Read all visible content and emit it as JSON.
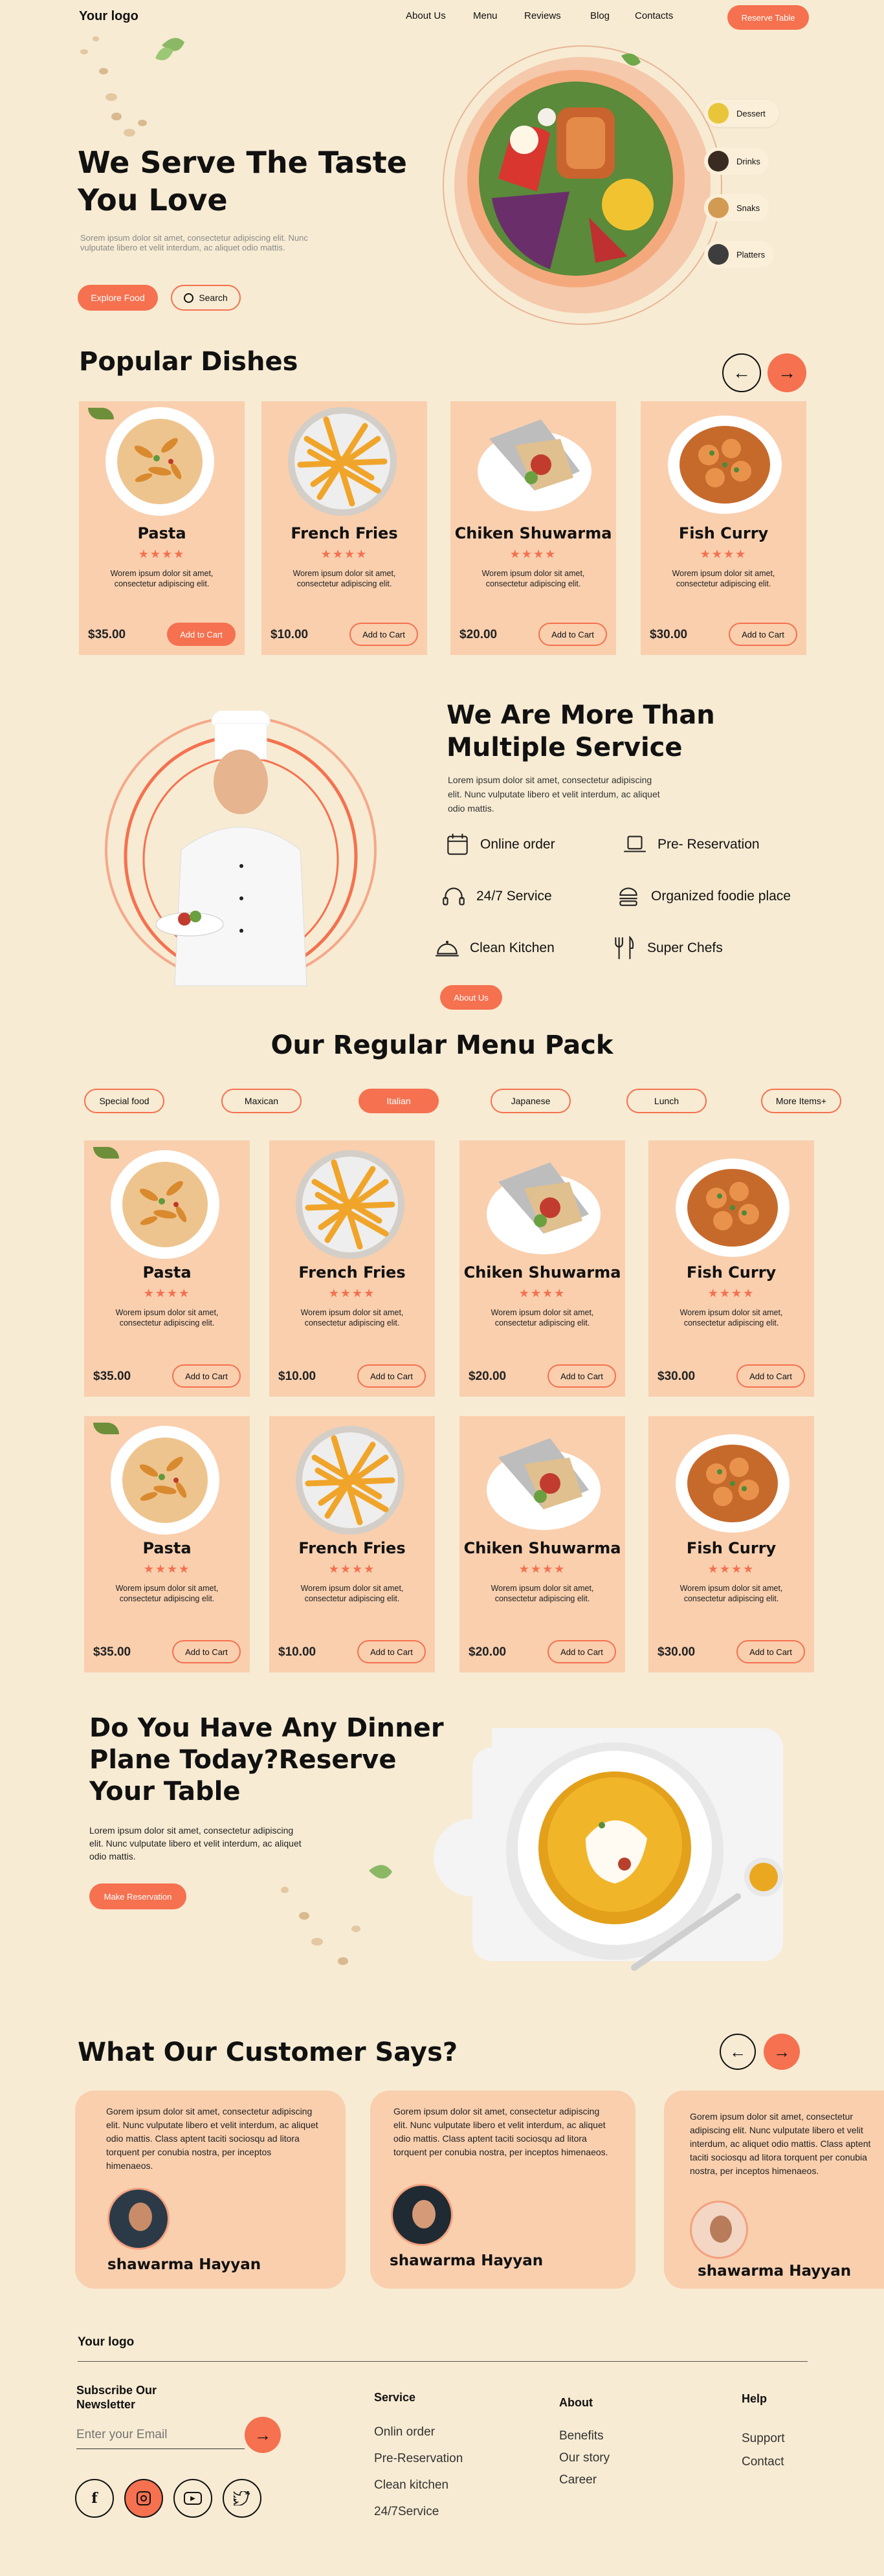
{
  "header": {
    "logo": "Your logo",
    "nav": [
      "About Us",
      "Menu",
      "Reviews",
      "Blog",
      "Contacts"
    ],
    "cta": "Reserve Table"
  },
  "hero": {
    "title_line1": "We Serve The Taste",
    "title_line2": "You Love",
    "text": "Sorem ipsum dolor sit amet, consectetur adipiscing elit. Nunc vulputate libero et velit interdum, ac aliquet odio mattis.",
    "explore": "Explore Food",
    "search": "Search",
    "categories": [
      "Dessert",
      "Drinks",
      "Snaks",
      "Platters"
    ]
  },
  "popular": {
    "title": "Popular Dishes",
    "dishes": [
      {
        "name": "Pasta",
        "price": "$35.00",
        "cart": "Add to Cart"
      },
      {
        "name": "French Fries",
        "price": "$10.00",
        "cart": "Add to Cart"
      },
      {
        "name": "Chiken Shuwarma",
        "price": "$20.00",
        "cart": "Add to Cart"
      },
      {
        "name": "Fish Curry",
        "price": "$30.00",
        "cart": "Add to Cart"
      }
    ],
    "stars": "★★★★",
    "desc": "Worem ipsum dolor sit amet, consectetur adipiscing elit."
  },
  "services": {
    "title_line1": "We Are More Than",
    "title_line2": "Multiple Service",
    "text": "Lorem ipsum dolor sit amet, consectetur adipiscing elit. Nunc vulputate libero et velit interdum, ac aliquet odio mattis.",
    "items": [
      "Online order",
      "Pre- Reservation",
      "24/7 Service",
      "Organized foodie place",
      "Clean Kitchen",
      "Super Chefs"
    ],
    "about": "About Us"
  },
  "menu": {
    "title": "Our Regular Menu Pack",
    "filters": [
      "Special food",
      "Maxican",
      "Italian",
      "Japanese",
      "Lunch",
      "More Items+"
    ],
    "active_filter": "Italian"
  },
  "reserve": {
    "title_line1": "Do You Have Any Dinner",
    "title_line2": "Plane Today?Reserve",
    "title_line3": "Your Table",
    "text": "Lorem ipsum dolor sit amet, consectetur adipiscing elit. Nunc vulputate libero et velit interdum, ac aliquet odio mattis.",
    "cta": "Make Reservation"
  },
  "testimonials": {
    "title": "What Our Customer Says?",
    "text": "Gorem ipsum dolor sit amet, consectetur adipiscing elit. Nunc vulputate libero et velit interdum, ac aliquet odio mattis. Class aptent taciti sociosqu ad litora torquent per conubia nostra, per inceptos himenaeos.",
    "name": "shawarma Hayyan"
  },
  "footer": {
    "logo": "Your logo",
    "subscribe": "Subscribe Our Newsletter",
    "email_placeholder": "Enter your Email",
    "cols": [
      {
        "title": "Service",
        "links": [
          "Onlin order",
          "Pre-Reservation",
          "Clean kitchen",
          "24/7Service"
        ]
      },
      {
        "title": "About",
        "links": [
          "Benefits",
          "Our story",
          "Career"
        ]
      },
      {
        "title": "Help",
        "links": [
          "Support",
          "Contact"
        ]
      }
    ]
  },
  "colors": {
    "accent": "#f5714f",
    "bg": "#f7ebd3",
    "card": "#f9cfae"
  }
}
